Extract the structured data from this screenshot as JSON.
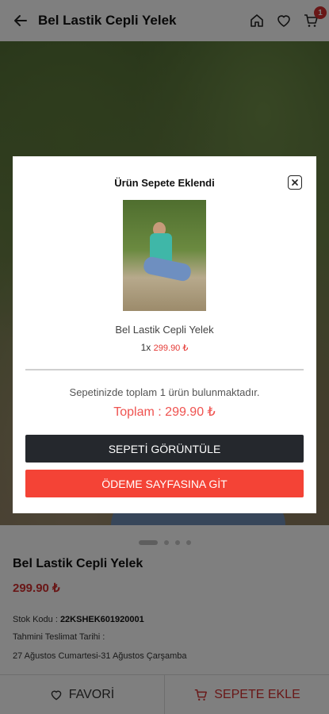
{
  "header": {
    "title": "Bel Lastik Cepli Yelek",
    "cart_badge": "1"
  },
  "product": {
    "name": "Bel Lastik Cepli Yelek",
    "price": "299.90 ₺",
    "stock_label": "Stok Kodu : ",
    "stock_code": "22KSHEK601920001",
    "delivery_label": "Tahmini Teslimat Tarihi :",
    "delivery_dates": "27 Ağustos Cumartesi-31 Ağustos Çarşamba"
  },
  "bottom_bar": {
    "favorite_label": "FAVORİ",
    "add_to_cart_label": "SEPETE EKLE"
  },
  "modal": {
    "title": "Ürün Sepete Eklendi",
    "product_name": "Bel Lastik Cepli Yelek",
    "quantity": "1x",
    "item_price": "299.90 ₺",
    "summary": "Sepetinizde toplam 1 ürün bulunmaktadır.",
    "total": "Toplam : 299.90 ₺",
    "view_cart_button": "SEPETİ GÖRÜNTÜLE",
    "checkout_button": "ÖDEME SAYFASINA GİT"
  },
  "colors": {
    "accent_red": "#f44336",
    "price_red": "#d32f2f",
    "dark_button": "#25282d"
  },
  "icons": [
    "back-arrow-icon",
    "home-icon",
    "heart-icon",
    "cart-icon",
    "close-icon"
  ]
}
